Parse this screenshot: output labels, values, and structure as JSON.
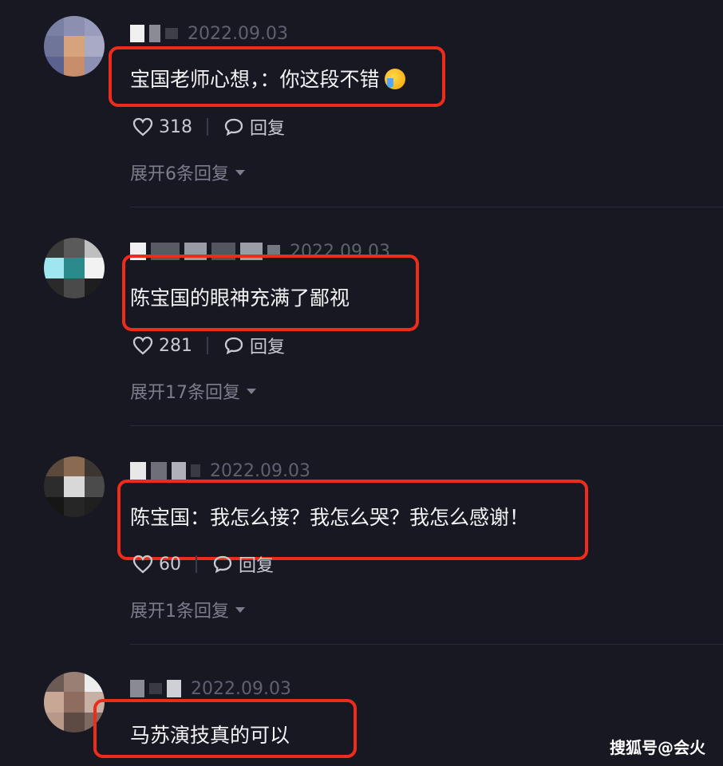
{
  "comments": [
    {
      "date": "2022.09.03",
      "text": "宝国老师心想，：你这段不错",
      "emoji": "crying-laughing-emoji",
      "likes": "318",
      "reply_label": "回复",
      "expand": "展开6条回复"
    },
    {
      "date": "2022.09.03",
      "text": "陈宝国的眼神充满了鄙视",
      "likes": "281",
      "reply_label": "回复",
      "expand": "展开17条回复"
    },
    {
      "date": "2022.09.03",
      "text": "陈宝国：我怎么接？我怎么哭？我怎么感谢！",
      "likes": "60",
      "reply_label": "回复",
      "expand": "展开1条回复"
    },
    {
      "date": "2022.09.03",
      "text": "马苏演技真的可以"
    }
  ],
  "colors": {
    "background": "#181823",
    "highlight": "#ef2c1c",
    "muted": "#7c7d8c"
  },
  "watermark": "搜狐号@会火"
}
